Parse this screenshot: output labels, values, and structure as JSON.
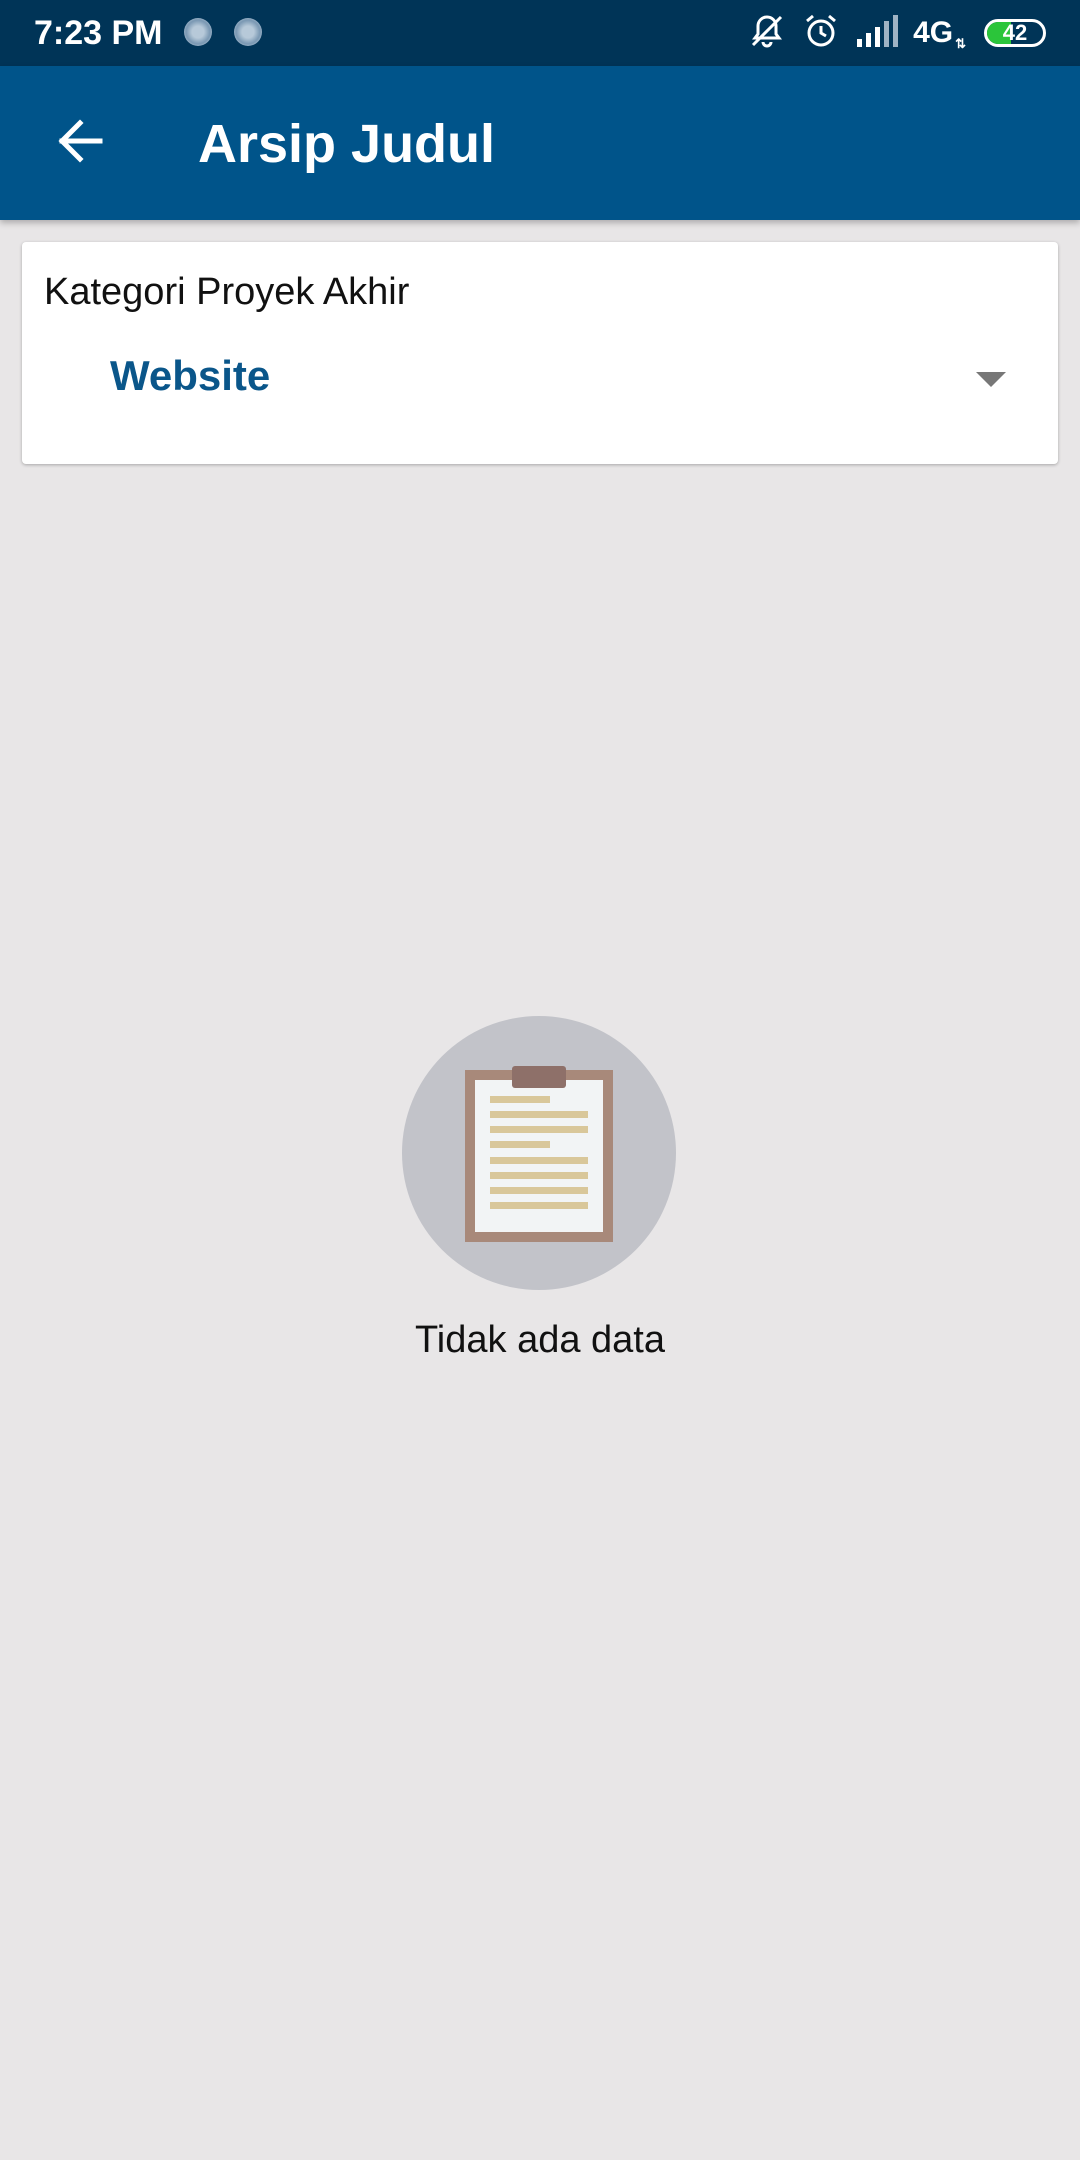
{
  "status_bar": {
    "time": "7:23 PM",
    "network": "4G",
    "battery_percent": "42",
    "battery_level": 0.42
  },
  "app_bar": {
    "title": "Arsip Judul"
  },
  "filter": {
    "label": "Kategori Proyek Akhir",
    "selected": "Website"
  },
  "empty_state": {
    "message": "Tidak ada data"
  },
  "colors": {
    "status_bar": "#003457",
    "app_bar": "#00548a",
    "accent_text": "#0a568a",
    "background": "#e8e6e7"
  }
}
